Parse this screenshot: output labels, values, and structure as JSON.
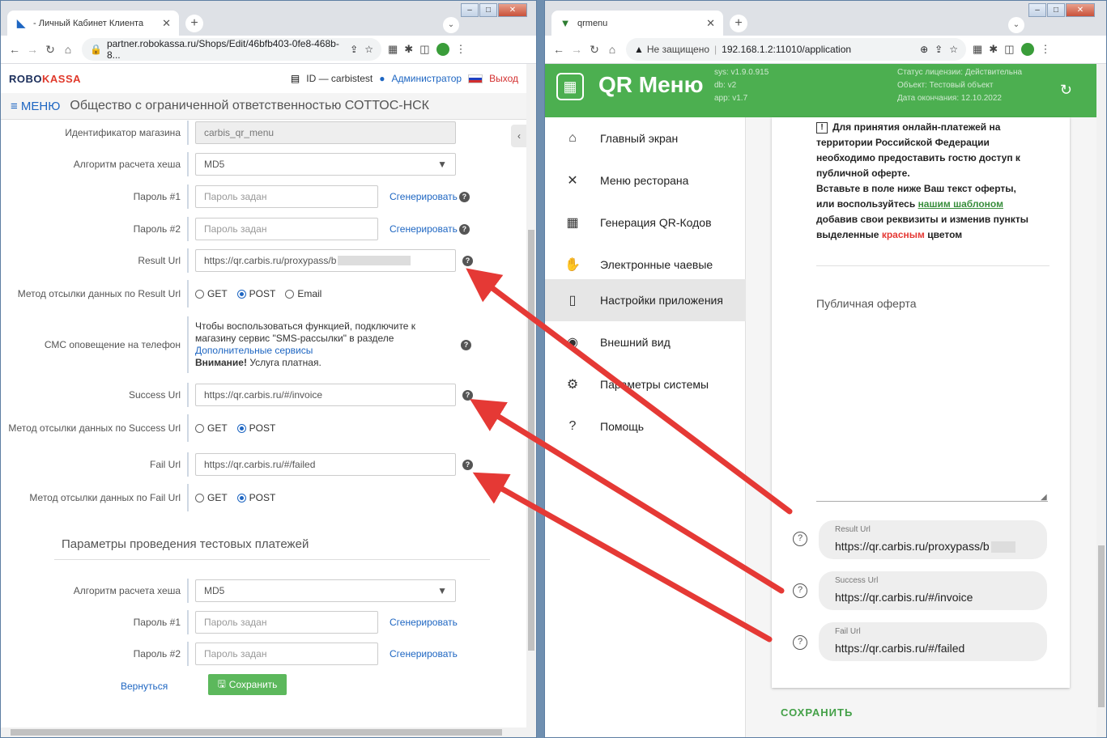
{
  "left": {
    "tab_title": "- Личный Кабинет Клиента",
    "url": "partner.robokassa.ru/Shops/Edit/46bfb403-0fe8-468b-8...",
    "logo_a": "ROBO",
    "logo_b": "KASSA",
    "id_label": "ID — carbistest",
    "role": "Администратор",
    "logout": "Выход",
    "menu": "≡ МЕНЮ",
    "org": "Общество с ограниченной ответственностью СОТТОС-НСК",
    "fields": {
      "shop_id_label": "Идентификатор магазина",
      "shop_id_value": "carbis_qr_menu",
      "hash_label": "Алгоритм расчета хеша",
      "hash_value": "MD5",
      "pass1_label": "Пароль #1",
      "pass2_label": "Пароль #2",
      "pass_placeholder": "Пароль задан",
      "generate": "Сгенерировать",
      "result_url_label": "Result Url",
      "result_url_value": "https://qr.carbis.ru/proxypass/b",
      "method_result_label": "Метод отсылки данных по Result Url",
      "sms_label": "СМС оповещение на телефон",
      "sms_text1": "Чтобы воспользоваться функцией, подключите к магазину сервис \"SMS-рассылки\" в разделе",
      "sms_link": "Дополнительные сервисы",
      "sms_warn": "Внимание!",
      "sms_paid": "Услуга платная.",
      "success_url_label": "Success Url",
      "success_url_value": "https://qr.carbis.ru/#/invoice",
      "method_success_label": "Метод отсылки данных по Success Url",
      "fail_url_label": "Fail Url",
      "fail_url_value": "https://qr.carbis.ru/#/failed",
      "method_fail_label": "Метод отсылки данных по Fail Url",
      "get": "GET",
      "post": "POST",
      "email": "Email"
    },
    "test_section": "Параметры проведения тестовых платежей",
    "back": "Вернуться",
    "save": "Сохранить"
  },
  "right": {
    "tab_title": "qrmenu",
    "insecure": "Не защищено",
    "url": "192.168.1.2:11010/application",
    "app_title": "QR Меню",
    "ver_sys": "sys: v1.9.0.915",
    "ver_db": "db: v2",
    "ver_app": "app: v1.7",
    "lic_status": "Статус лицензии: Действительна",
    "lic_object": "Объект: Тестовый объект",
    "lic_end": "Дата окончания: 12.10.2022",
    "nav": [
      "Главный экран",
      "Меню ресторана",
      "Генерация QR-Кодов",
      "Электронные чаевые",
      "Настройки приложения",
      "Внешний вид",
      "Параметры системы",
      "Помощь"
    ],
    "warn_1": "Для принятия онлайн-платежей на территории Российской Федерации необходимо предоставить гостю доступ к публичной оферте.",
    "warn_2": "Вставьте в поле ниже Ваш текст оферты, или воспользуйтесь",
    "warn_link": "нашим шаблоном",
    "warn_3": "добавив свои реквизиты и изменив пункты выделенные",
    "warn_red": "красным",
    "warn_4": "цветом",
    "offer_placeholder": "Публичная оферта",
    "result_label": "Result Url",
    "result_value": "https://qr.carbis.ru/proxypass/b",
    "success_label": "Success Url",
    "success_value": "https://qr.carbis.ru/#/invoice",
    "fail_label": "Fail Url",
    "fail_value": "https://qr.carbis.ru/#/failed",
    "save": "СОХРАНИТЬ"
  },
  "colors": {
    "accent_green": "#4caf50",
    "arrow_red": "#e53935",
    "link_blue": "#1e66c2"
  }
}
